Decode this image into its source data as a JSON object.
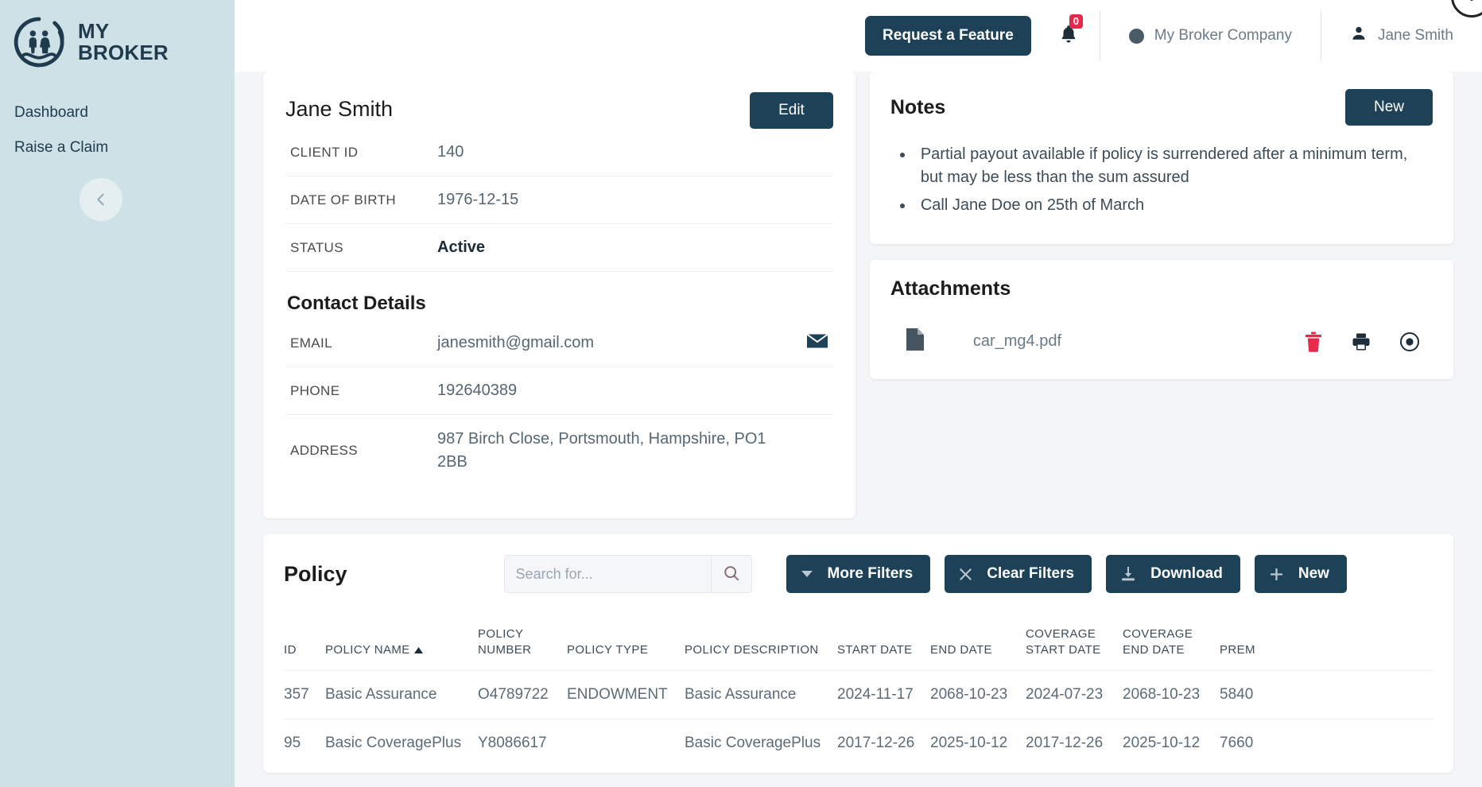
{
  "brand": {
    "line1": "MY",
    "line2": "BROKER",
    "logo_icon": "family-circle-logo"
  },
  "sidebar": {
    "items": [
      {
        "label": "Dashboard"
      },
      {
        "label": "Raise a Claim"
      }
    ],
    "collapse_icon": "chevron-left-icon"
  },
  "topbar": {
    "feature_button": "Request a Feature",
    "bell_icon": "bell-icon",
    "notification_count": "0",
    "company": "My Broker Company",
    "user": "Jane Smith"
  },
  "client": {
    "name": "Jane Smith",
    "edit_label": "Edit",
    "fields": [
      {
        "label": "CLIENT ID",
        "value": "140"
      },
      {
        "label": "DATE OF BIRTH",
        "value": "1976-12-15"
      },
      {
        "label": "STATUS",
        "value": "Active"
      }
    ],
    "contact_title": "Contact Details",
    "contact": [
      {
        "label": "EMAIL",
        "value": "janesmith@gmail.com"
      },
      {
        "label": "PHONE",
        "value": "192640389"
      },
      {
        "label": "ADDRESS",
        "value": "987 Birch Close, Portsmouth, Hampshire, PO1 2BB"
      }
    ]
  },
  "notes": {
    "title": "Notes",
    "new_label": "New",
    "items": [
      "Partial payout available if policy is surrendered after a minimum term, but may be less than the sum assured",
      "Call Jane Doe on 25th of March"
    ]
  },
  "attachments": {
    "title": "Attachments",
    "files": [
      {
        "name": "car_mg4.pdf",
        "file_icon": "pdf-file-icon",
        "delete_icon": "trash-icon",
        "print_icon": "printer-icon",
        "view_icon": "eye-icon"
      }
    ]
  },
  "policy": {
    "title": "Policy",
    "search_placeholder": "Search for...",
    "search_value": "",
    "buttons": {
      "more_filters": "More Filters",
      "clear_filters": "Clear Filters",
      "download": "Download",
      "new": "New"
    },
    "columns": [
      "ID",
      "POLICY NAME",
      "POLICY\nNUMBER",
      "POLICY TYPE",
      "POLICY DESCRIPTION",
      "START DATE",
      "END DATE",
      "COVERAGE\nSTART DATE",
      "COVERAGE\nEND DATE",
      "PREM"
    ],
    "sorted_column": "POLICY NAME",
    "sort_direction": "asc",
    "rows": [
      {
        "id": "357",
        "policy_name": "Basic Assurance",
        "policy_number": "O4789722",
        "policy_type": "ENDOWMENT",
        "policy_description": "Basic Assurance",
        "start_date": "2024-11-17",
        "end_date": "2068-10-23",
        "coverage_start_date": "2024-07-23",
        "coverage_end_date": "2068-10-23",
        "premium": "5840"
      },
      {
        "id": "95",
        "policy_name": "Basic CoveragePlus",
        "policy_number": "Y8086617",
        "policy_type": "",
        "policy_description": "Basic CoveragePlus",
        "start_date": "2017-12-26",
        "end_date": "2025-10-12",
        "coverage_start_date": "2017-12-26",
        "coverage_end_date": "2025-10-12",
        "premium": "7660"
      }
    ]
  },
  "colors": {
    "sidebar_bg": "#cde1e7",
    "accent_dark": "#1d4257",
    "badge_red": "#e8284b",
    "trash_red": "#e8294b"
  }
}
